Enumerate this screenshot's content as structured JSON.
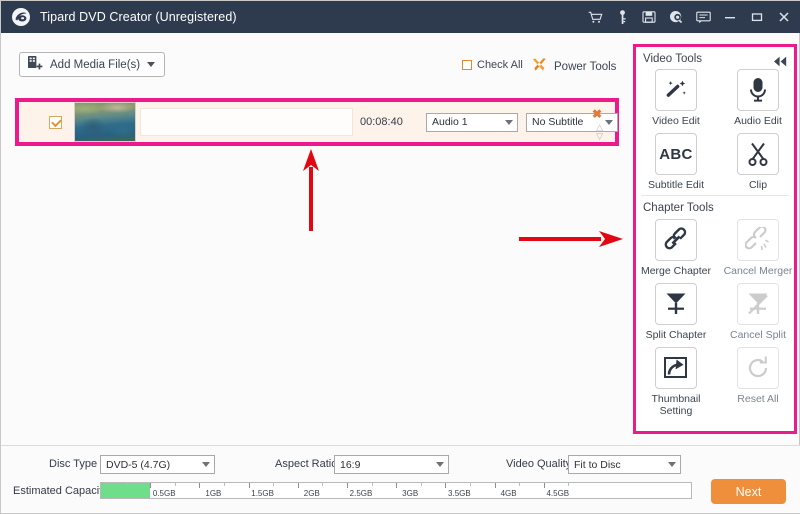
{
  "window": {
    "title": "Tipard DVD Creator (Unregistered)",
    "logo_icon": "tipard-swirl-logo",
    "titlebar_bg": "#2e3b4e",
    "icons": [
      {
        "name": "cart-icon",
        "glyph": "cart"
      },
      {
        "name": "key-icon",
        "glyph": "key"
      },
      {
        "name": "save-icon",
        "glyph": "save"
      },
      {
        "name": "help-search-icon",
        "glyph": "help"
      },
      {
        "name": "feedback-icon",
        "glyph": "feedback"
      },
      {
        "name": "minimize-icon",
        "glyph": "minimize"
      },
      {
        "name": "maximize-icon",
        "glyph": "maximize"
      },
      {
        "name": "close-icon",
        "glyph": "close"
      }
    ]
  },
  "toolbar": {
    "add_media_label": "Add Media File(s)",
    "add_media_icon": "add-file-icon",
    "check_all_label": "Check All",
    "check_all_checked": false,
    "power_tools_label": "Power Tools",
    "power_tools_icon": "crossed-tools-icon",
    "accent_color": "#e08a2e"
  },
  "media_list": {
    "highlight_color": "#ec1a8b",
    "rows": [
      {
        "checked": true,
        "thumbnail": "aerial-harbor-city-thumbnail",
        "title": "",
        "duration": "00:08:40",
        "audio_track": "Audio 1",
        "subtitle_track": "No Subtitle",
        "remove_label": "✖",
        "reorder_icon": "up-down-spinner-icon"
      }
    ]
  },
  "annotations": {
    "arrow_color": "#e30613",
    "arrows": [
      {
        "name": "arrow-up-annotation",
        "direction": "up"
      },
      {
        "name": "arrow-right-annotation",
        "direction": "right"
      }
    ]
  },
  "right_panel": {
    "highlight_color": "#ec1a8b",
    "collapse_icon": "double-chevron-left-icon",
    "sections": [
      {
        "title": "Video Tools",
        "tools": [
          {
            "label": "Video Edit",
            "icon": "magic-wand-icon",
            "enabled": true
          },
          {
            "label": "Audio Edit",
            "icon": "microphone-icon",
            "enabled": true
          },
          {
            "label": "Subtitle Edit",
            "icon": "abc-text-icon",
            "enabled": true
          },
          {
            "label": "Clip",
            "icon": "scissors-icon",
            "enabled": true
          }
        ]
      },
      {
        "title": "Chapter Tools",
        "tools": [
          {
            "label": "Merge Chapter",
            "icon": "chain-link-icon",
            "enabled": true
          },
          {
            "label": "Cancel Merger",
            "icon": "broken-chain-icon",
            "enabled": false
          },
          {
            "label": "Split Chapter",
            "icon": "split-arrow-icon",
            "enabled": true
          },
          {
            "label": "Cancel Split",
            "icon": "cancel-split-icon",
            "enabled": false
          },
          {
            "label": "Thumbnail Setting",
            "icon": "thumbnail-export-icon",
            "enabled": true
          },
          {
            "label": "Reset All",
            "icon": "reset-circular-icon",
            "enabled": false
          }
        ]
      }
    ]
  },
  "bottom_bar": {
    "disc_type_label": "Disc Type",
    "disc_type_value": "DVD-5 (4.7G)",
    "aspect_ratio_label": "Aspect Ratio:",
    "aspect_ratio_value": "16:9",
    "video_quality_label": "Video Quality:",
    "video_quality_value": "Fit to Disc",
    "capacity_label": "Estimated Capacity:",
    "capacity_fill_color": "#6ede8a",
    "capacity_ticks": [
      "0.5GB",
      "1GB",
      "1.5GB",
      "2GB",
      "2.5GB",
      "3GB",
      "3.5GB",
      "4GB",
      "4.5GB"
    ],
    "next_label": "Next",
    "next_color": "#ef8e3b"
  }
}
